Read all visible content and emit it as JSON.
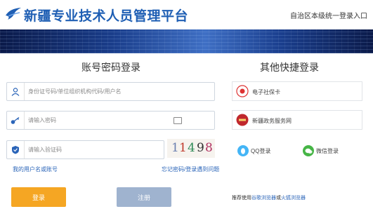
{
  "header": {
    "title": "新疆专业技术人员管理平台",
    "right_link": "自治区本级统一登录入口",
    "logo_icon": "bird-logo-icon"
  },
  "login": {
    "title": "账号密码登录",
    "username_placeholder": "身份证号码/单位组织机构代码/用户名",
    "password_placeholder": "请输入密码",
    "captcha_placeholder": "请输入验证码",
    "captcha_code": [
      "1",
      "1",
      "4",
      "9",
      "8"
    ],
    "forgot_account": "我的用户名或账号",
    "captcha_refresh": "忘记密码/登录遇到问题",
    "login_button": "登录",
    "register_button": "注册"
  },
  "quick": {
    "title": "其他快捷登录",
    "items": [
      {
        "label": "电子社保卡",
        "icon": "social-security-card-icon"
      },
      {
        "label": "新疆政务服务网",
        "icon": "xinjiang-gov-icon"
      }
    ],
    "social": [
      {
        "label": "QQ登录",
        "icon": "qq-icon",
        "color": "#44b5f6"
      },
      {
        "label": "微信登录",
        "icon": "wechat-icon",
        "color": "#46b546"
      }
    ],
    "browser_tip_prefix": "推荐使用",
    "browser_tip_a": "谷歌浏览器",
    "browser_tip_sep": "或",
    "browser_tip_b": "火狐浏览器"
  },
  "colors": {
    "brand": "#1f5fb4",
    "login_button": "#f5a623",
    "register_button": "#9fb3cf"
  }
}
